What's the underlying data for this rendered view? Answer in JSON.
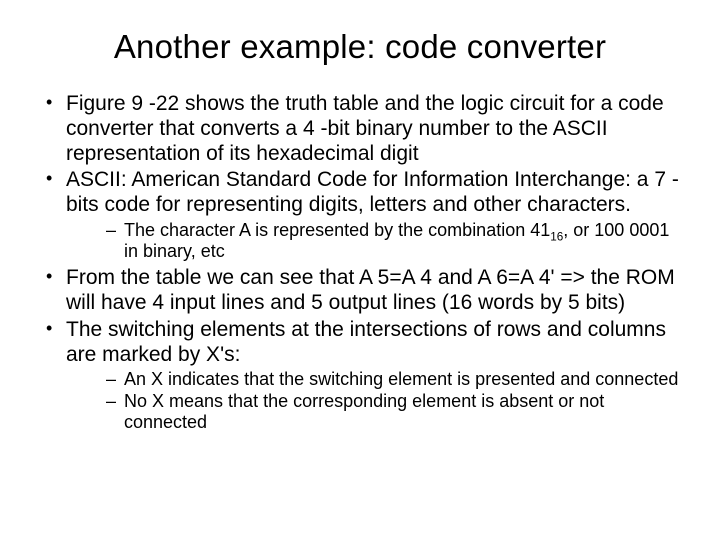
{
  "title": "Another example: code converter",
  "bullets": {
    "b1": "Figure 9 -22 shows the truth table and the logic circuit for a code converter that converts a 4 -bit binary number to the ASCII representation of its hexadecimal digit",
    "b2": "ASCII: American Standard Code for Information Interchange: a 7 -bits code for representing digits, letters and other characters.",
    "b2s1_a": "The character A is represented by the combination 41",
    "b2s1_sub": "16",
    "b2s1_b": ", or 100 0001 in binary, etc",
    "b3": "From the table we can see that A 5=A 4 and A 6=A 4' => the ROM will have 4 input lines and 5 output lines (16 words by 5 bits)",
    "b4": "The switching elements at the intersections of rows and columns are marked by X's:",
    "b4s1": "An X indicates that the switching element is presented and connected",
    "b4s2": "No X means that the corresponding element is absent or not connected"
  }
}
